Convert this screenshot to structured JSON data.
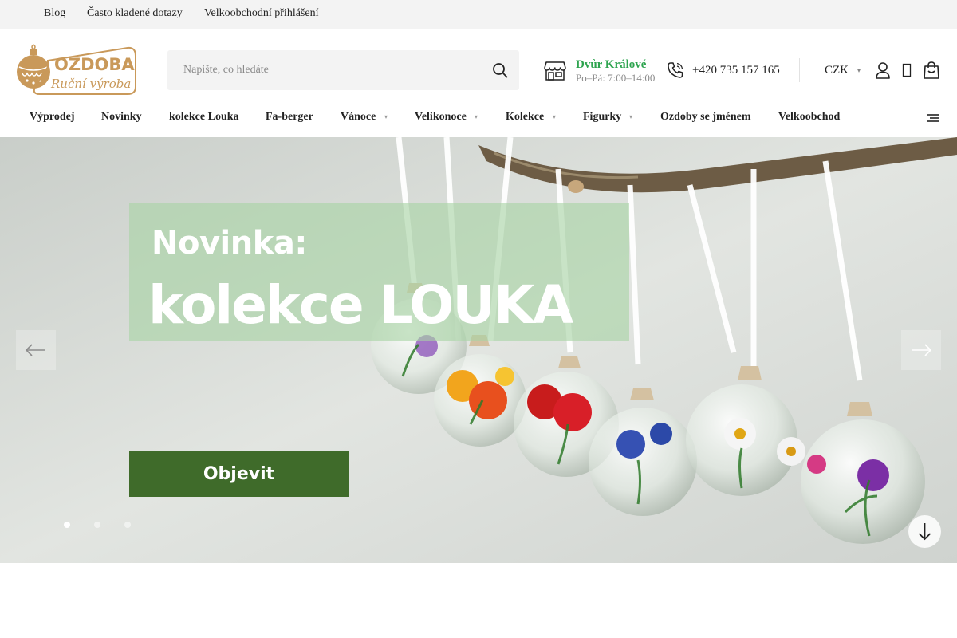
{
  "topbar": {
    "links": [
      "Blog",
      "Často kladené dotazy",
      "Velkoobchodní přihlášení"
    ]
  },
  "logo": {
    "name": "OZDOBA",
    "tagline": "Ruční výroba",
    "color": "#c9995a"
  },
  "search": {
    "placeholder": "Napište, co hledáte",
    "icon": "search-icon"
  },
  "store": {
    "icon": "store-icon",
    "city": "Dvůr Králové",
    "hours": "Po–Pá: 7:00–14:00",
    "city_color": "#2ea44f"
  },
  "phone": {
    "icon": "phone-icon",
    "number": "+420 735 157 165"
  },
  "currency": {
    "selected": "CZK"
  },
  "icons": {
    "user": "user-icon",
    "heart": "heart-icon",
    "cart": "cart-icon",
    "menu": "menu-icon"
  },
  "nav": {
    "items": [
      {
        "label": "Výprodej",
        "has_submenu": false
      },
      {
        "label": "Novinky",
        "has_submenu": false
      },
      {
        "label": "kolekce Louka",
        "has_submenu": false
      },
      {
        "label": "Fa-berger",
        "has_submenu": false
      },
      {
        "label": "Vánoce",
        "has_submenu": true
      },
      {
        "label": "Velikonoce",
        "has_submenu": true
      },
      {
        "label": "Kolekce",
        "has_submenu": true
      },
      {
        "label": "Figurky",
        "has_submenu": true
      },
      {
        "label": "Ozdoby se jménem",
        "has_submenu": false
      },
      {
        "label": "Velkoobchod",
        "has_submenu": false
      }
    ]
  },
  "hero": {
    "line1": "Novinka:",
    "line2": "kolekce LOUKA",
    "cta": "Objevit",
    "cta_color": "#3f6b2a",
    "slides_total": 3,
    "active_slide": 1
  }
}
